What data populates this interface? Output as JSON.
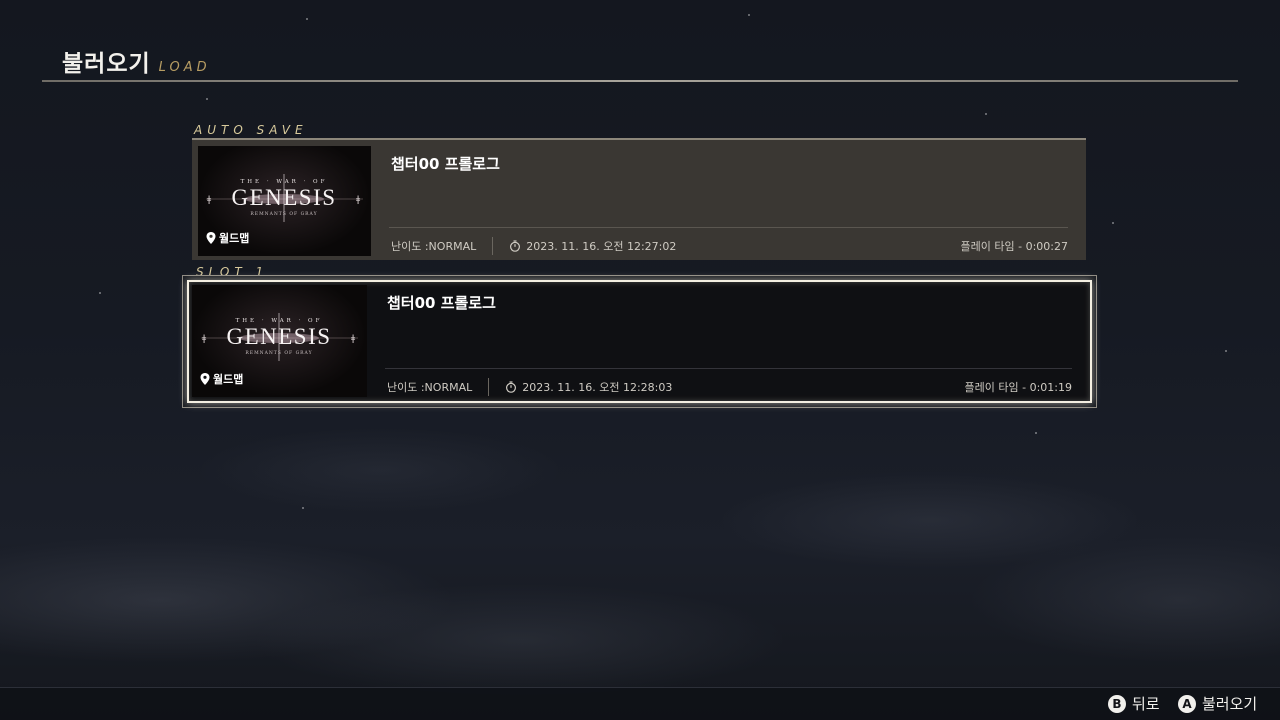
{
  "header": {
    "title": "불러오기",
    "subtitle": "LOAD"
  },
  "sections": {
    "auto_save": "AUTO SAVE",
    "slot1": "SLOT 1"
  },
  "logo": {
    "top": "THE · WAR · OF",
    "main": "GENESIS",
    "sub": "REMNANTS OF GRAY"
  },
  "slots": [
    {
      "chapter": "챕터00 프롤로그",
      "location": "월드맵",
      "difficulty": "난이도 :NORMAL",
      "datetime": "2023. 11. 16. 오전 12:27:02",
      "playtime": "플레이 타임 - 0:00:27",
      "selected": false
    },
    {
      "chapter": "챕터00 프롤로그",
      "location": "월드맵",
      "difficulty": "난이도 :NORMAL",
      "datetime": "2023. 11. 16. 오전 12:28:03",
      "playtime": "플레이 타임 - 0:01:19",
      "selected": true
    }
  ],
  "footer": {
    "back": {
      "button": "B",
      "label": "뒤로"
    },
    "load": {
      "button": "A",
      "label": "불러오기"
    }
  },
  "colors": {
    "accent_gold": "#b79d63",
    "selection_glow": "#f4efe2",
    "autosave_bg": "#3a3733"
  }
}
